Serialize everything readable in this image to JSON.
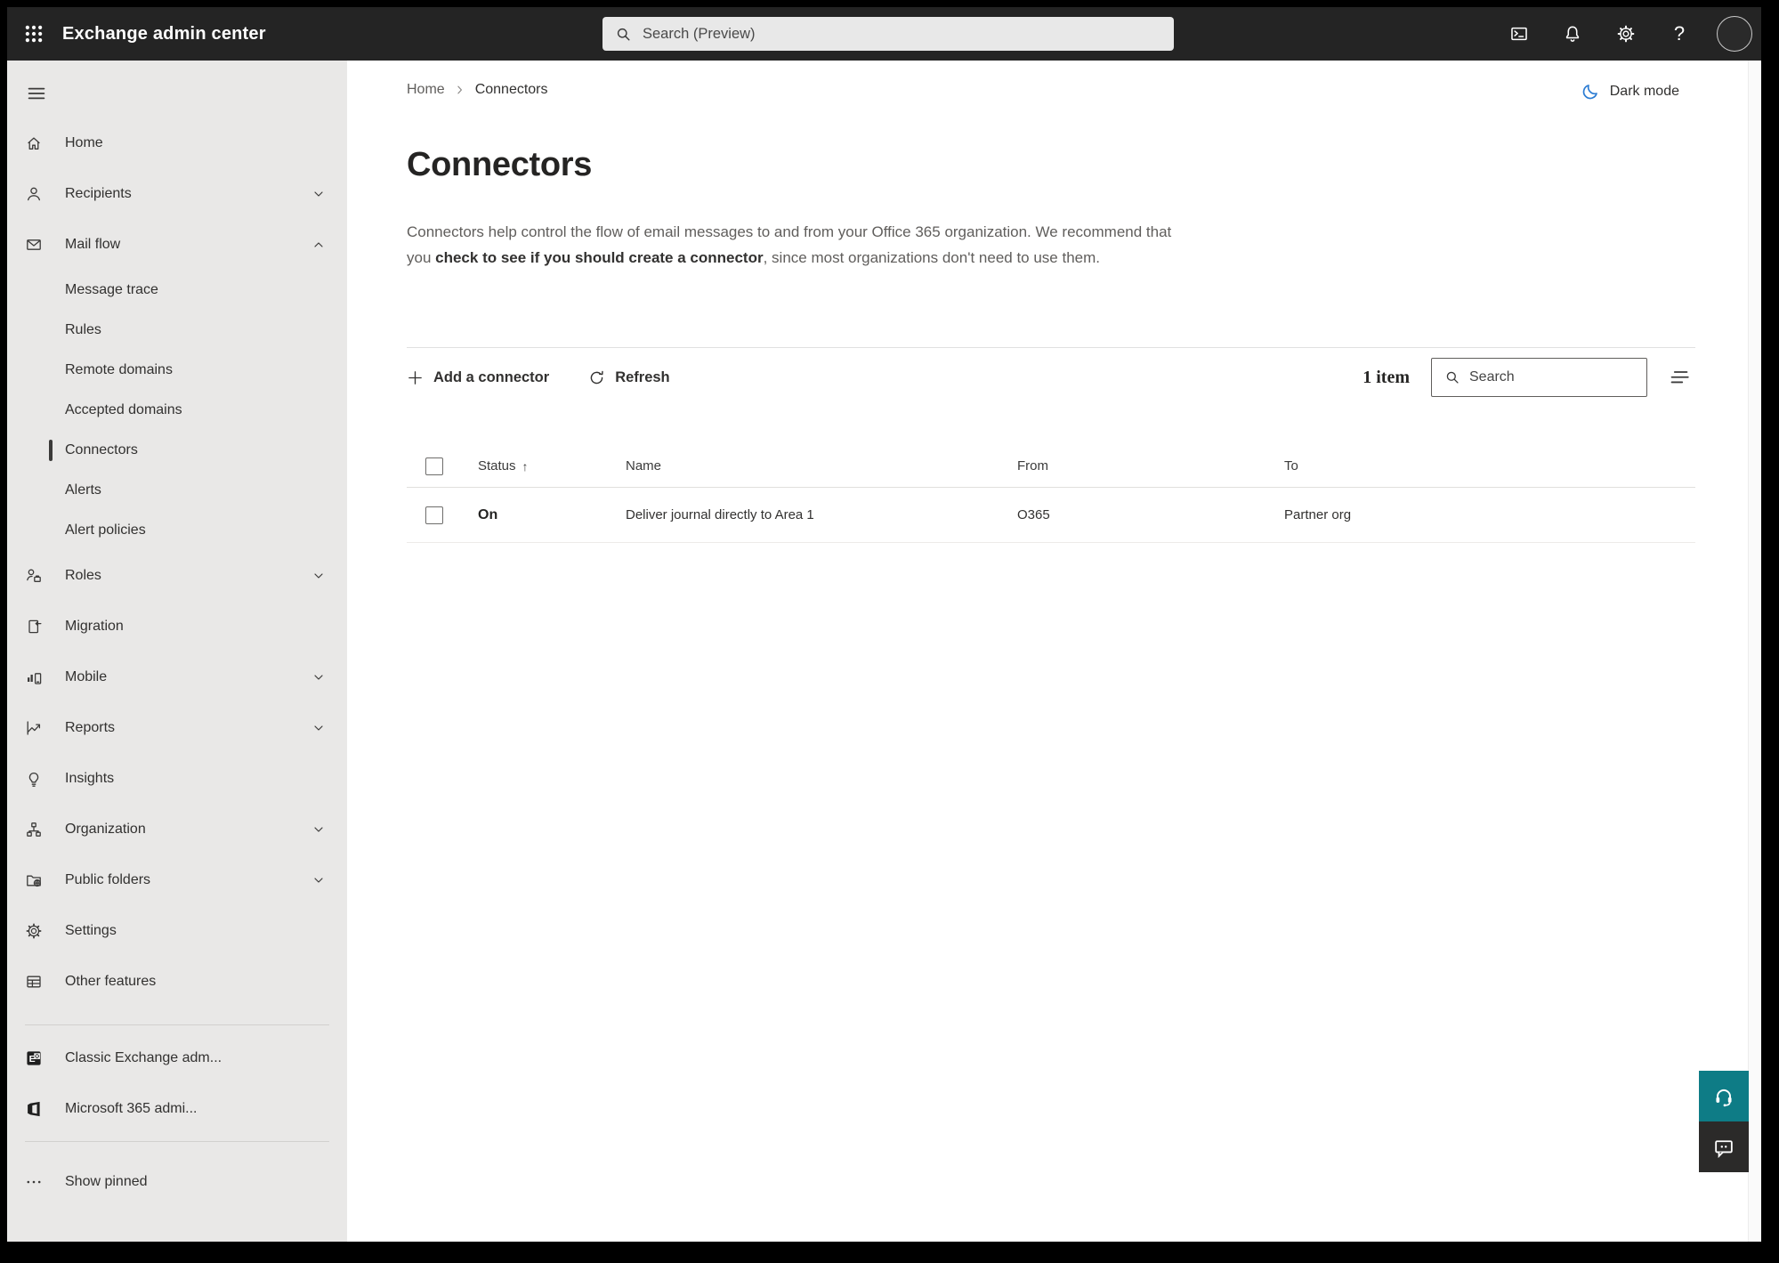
{
  "topbar": {
    "title": "Exchange admin center",
    "search_placeholder": "Search (Preview)",
    "icons": [
      "app-launcher-icon",
      "cloud-shell-icon",
      "notifications-bell-icon",
      "settings-gear-icon",
      "help-icon",
      "avatar"
    ]
  },
  "sidebar": {
    "items": [
      {
        "label": "Home",
        "icon": "home-icon"
      },
      {
        "label": "Recipients",
        "icon": "person-icon",
        "chevron": "down"
      },
      {
        "label": "Mail flow",
        "icon": "mail-icon",
        "chevron": "up",
        "expanded": true
      },
      {
        "label": "Message trace",
        "child_of": "Mail flow"
      },
      {
        "label": "Rules",
        "child_of": "Mail flow"
      },
      {
        "label": "Remote domains",
        "child_of": "Mail flow"
      },
      {
        "label": "Accepted domains",
        "child_of": "Mail flow"
      },
      {
        "label": "Connectors",
        "child_of": "Mail flow",
        "selected": true
      },
      {
        "label": "Alerts",
        "child_of": "Mail flow"
      },
      {
        "label": "Alert policies",
        "child_of": "Mail flow"
      },
      {
        "label": "Roles",
        "icon": "roles-icon",
        "chevron": "down"
      },
      {
        "label": "Migration",
        "icon": "migration-icon"
      },
      {
        "label": "Mobile",
        "icon": "mobile-icon",
        "chevron": "down"
      },
      {
        "label": "Reports",
        "icon": "reports-icon",
        "chevron": "down"
      },
      {
        "label": "Insights",
        "icon": "insights-lightbulb-icon"
      },
      {
        "label": "Organization",
        "icon": "organization-icon",
        "chevron": "down"
      },
      {
        "label": "Public folders",
        "icon": "public-folders-icon",
        "chevron": "down"
      },
      {
        "label": "Settings",
        "icon": "settings-gear-icon"
      },
      {
        "label": "Other features",
        "icon": "other-features-table-icon"
      }
    ],
    "footer_items": [
      {
        "label": "Classic Exchange adm...",
        "icon": "classic-exchange-icon"
      },
      {
        "label": "Microsoft 365 admi...",
        "icon": "microsoft-365-icon"
      }
    ],
    "show_pinned_label": "Show pinned"
  },
  "breadcrumb": {
    "home": "Home",
    "current": "Connectors"
  },
  "theme_toggle": {
    "label": "Dark mode",
    "icon": "moon-icon"
  },
  "page": {
    "title": "Connectors",
    "description_start": "Connectors help control the flow of email messages to and from your Office 365 organization. We recommend that you ",
    "description_link": "check to see if you should create a connector",
    "description_end": ", since most organizations don't need to use them."
  },
  "toolbar": {
    "add_button": "Add a connector",
    "refresh_button": "Refresh",
    "item_count": "1 item",
    "search_placeholder": "Search"
  },
  "table": {
    "columns": [
      "Status",
      "Name",
      "From",
      "To"
    ],
    "sort": {
      "column": "Status",
      "direction": "ascending"
    },
    "rows": [
      {
        "status": "On",
        "name": "Deliver journal directly to Area 1",
        "from": "O365",
        "to": "Partner org"
      }
    ]
  },
  "colors": {
    "topbar_bg": "#242424",
    "sidebar_bg": "#e9e8e7",
    "accent_blue": "#2b7cd3",
    "help_teal": "#0e7c86",
    "feedback_dark": "#2b2a29",
    "text_primary": "#323130",
    "text_secondary": "#605e5c"
  }
}
